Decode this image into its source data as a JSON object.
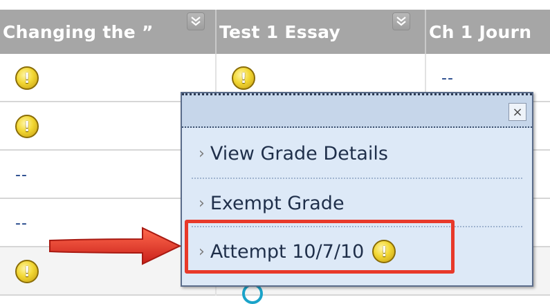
{
  "grade_center": {
    "columns": [
      {
        "label": "Changing the ”"
      },
      {
        "label": "Test 1 Essay"
      },
      {
        "label": "Ch 1 Journ"
      }
    ],
    "rows": [
      {
        "col1": "warning",
        "col2": "warning",
        "col3": "--"
      },
      {
        "col1": "warning",
        "col2": "",
        "col3": ""
      },
      {
        "col1": "--",
        "col2": "",
        "col3": ""
      },
      {
        "col1": "--",
        "col2": "",
        "col3": ""
      },
      {
        "col1": "warning",
        "col2": "",
        "col3": ""
      }
    ],
    "empty_value": "--",
    "warning_glyph": "!"
  },
  "context_menu": {
    "close_label": "×",
    "chevron": "›",
    "items": [
      {
        "label": "View Grade Details"
      },
      {
        "label": "Exempt Grade"
      },
      {
        "label": "Attempt 10/7/10"
      }
    ]
  },
  "annotation": {
    "highlight_color": "#e8392a",
    "arrow_color": "#e8392a",
    "highlighted_item": "Attempt 10/7/10"
  },
  "colors": {
    "header_bg": "#a6a6a6",
    "popup_bg": "#dde9f7",
    "link_text": "#1f2f4a",
    "dash_text": "#1a3f86"
  }
}
